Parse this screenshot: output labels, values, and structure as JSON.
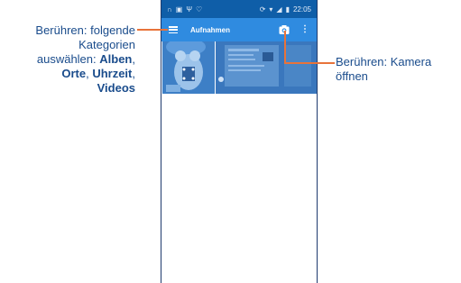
{
  "status_bar": {
    "time": "22:05",
    "left_icons": [
      "headset-icon",
      "image-icon",
      "usb-icon",
      "notification-icon"
    ],
    "right_icons": [
      "sync-icon",
      "wifi-icon",
      "signal-icon",
      "battery-icon"
    ]
  },
  "app_bar": {
    "title": "Aufnahmen",
    "menu_icon": "hamburger-menu-icon",
    "camera_icon": "camera-icon",
    "overflow_icon": "more-vertical-icon"
  },
  "callouts": {
    "left": {
      "line1": "Berühren: folgende",
      "line2": "Kategorien",
      "line3_prefix": "auswählen: ",
      "item1": "Alben",
      "sep1": ",",
      "item2": "Orte",
      "sep2": ",",
      "item3": "Uhrzeit",
      "sep3": ",",
      "item4": "Videos"
    },
    "right": {
      "line1": "Berühren: Kamera",
      "line2": "öffnen"
    }
  },
  "colors": {
    "status_bar": "#0f5ea8",
    "app_bar": "#2f8be0",
    "callout_text": "#1a4c8c",
    "callout_line": "#e8733a"
  }
}
